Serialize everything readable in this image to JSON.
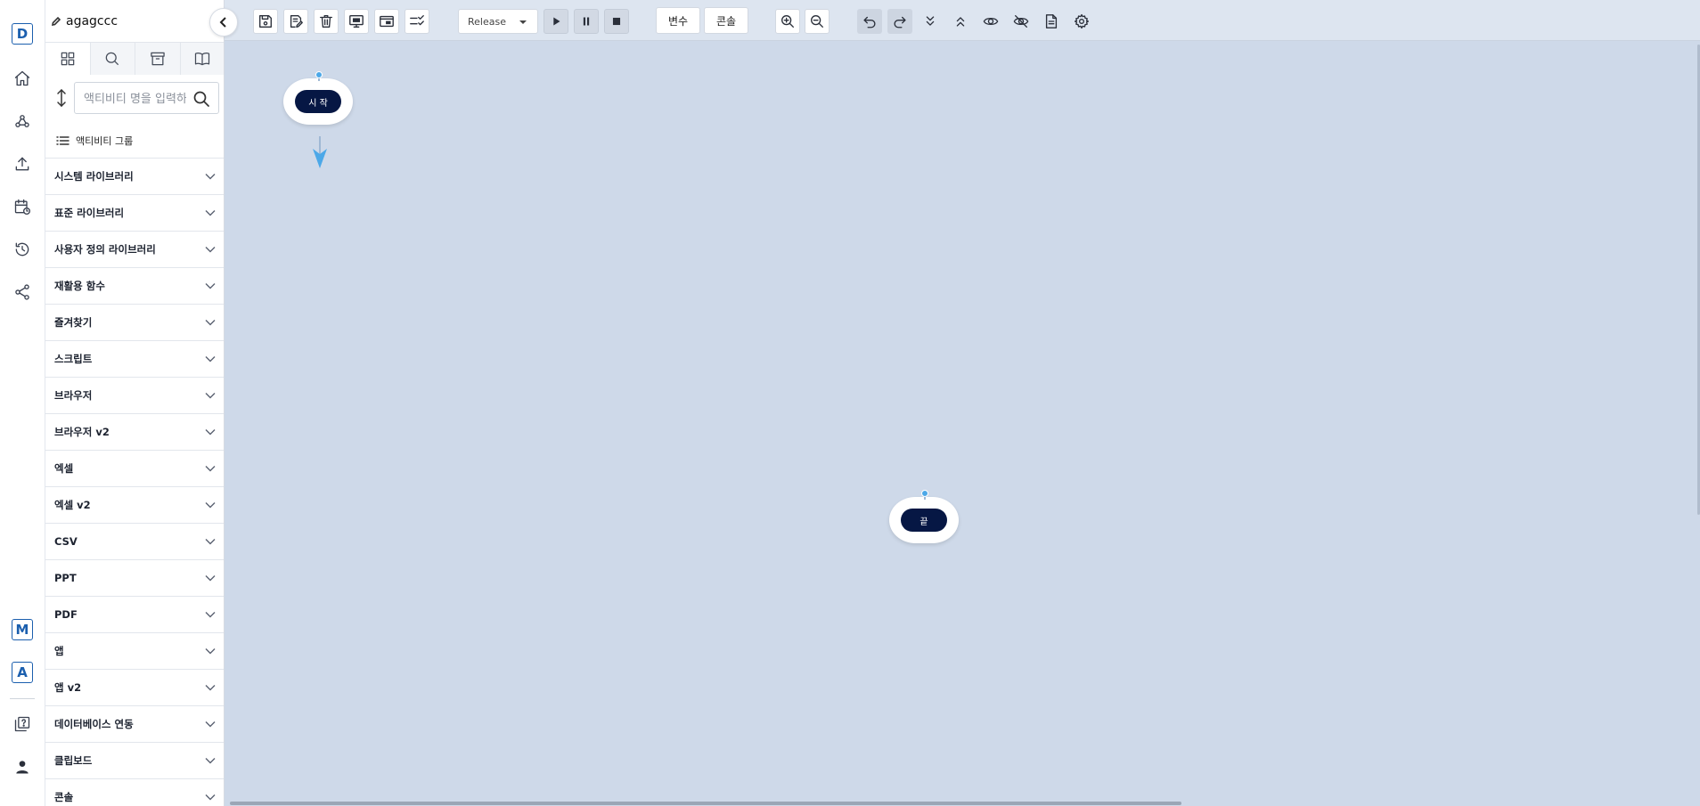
{
  "rail": {
    "logo": "D",
    "bottom_badges": [
      "M",
      "A"
    ]
  },
  "project": {
    "name": "agagccc"
  },
  "panel": {
    "search_placeholder": "액티비티 명을 입력하세요",
    "group_header": "액티비티 그룹",
    "categories": [
      "시스템 라이브러리",
      "표준 라이브러리",
      "사용자 정의 라이브러리",
      "재활용 함수",
      "즐겨찾기",
      "스크립트",
      "브라우저",
      "브라우저 v2",
      "엑셀",
      "엑셀 v2",
      "CSV",
      "PPT",
      "PDF",
      "앱",
      "앱 v2",
      "데이터베이스 연동",
      "클립보드",
      "콘솔"
    ]
  },
  "toolbar": {
    "mode": "Release",
    "variables_label": "변수",
    "console_label": "콘솔"
  },
  "canvas": {
    "start_label": "시 작",
    "end_label": "끝"
  },
  "colors": {
    "canvas_bg": "#ced9e9",
    "node_pill": "#061744",
    "port": "#4ca8e8",
    "brand": "#1b5fae"
  }
}
